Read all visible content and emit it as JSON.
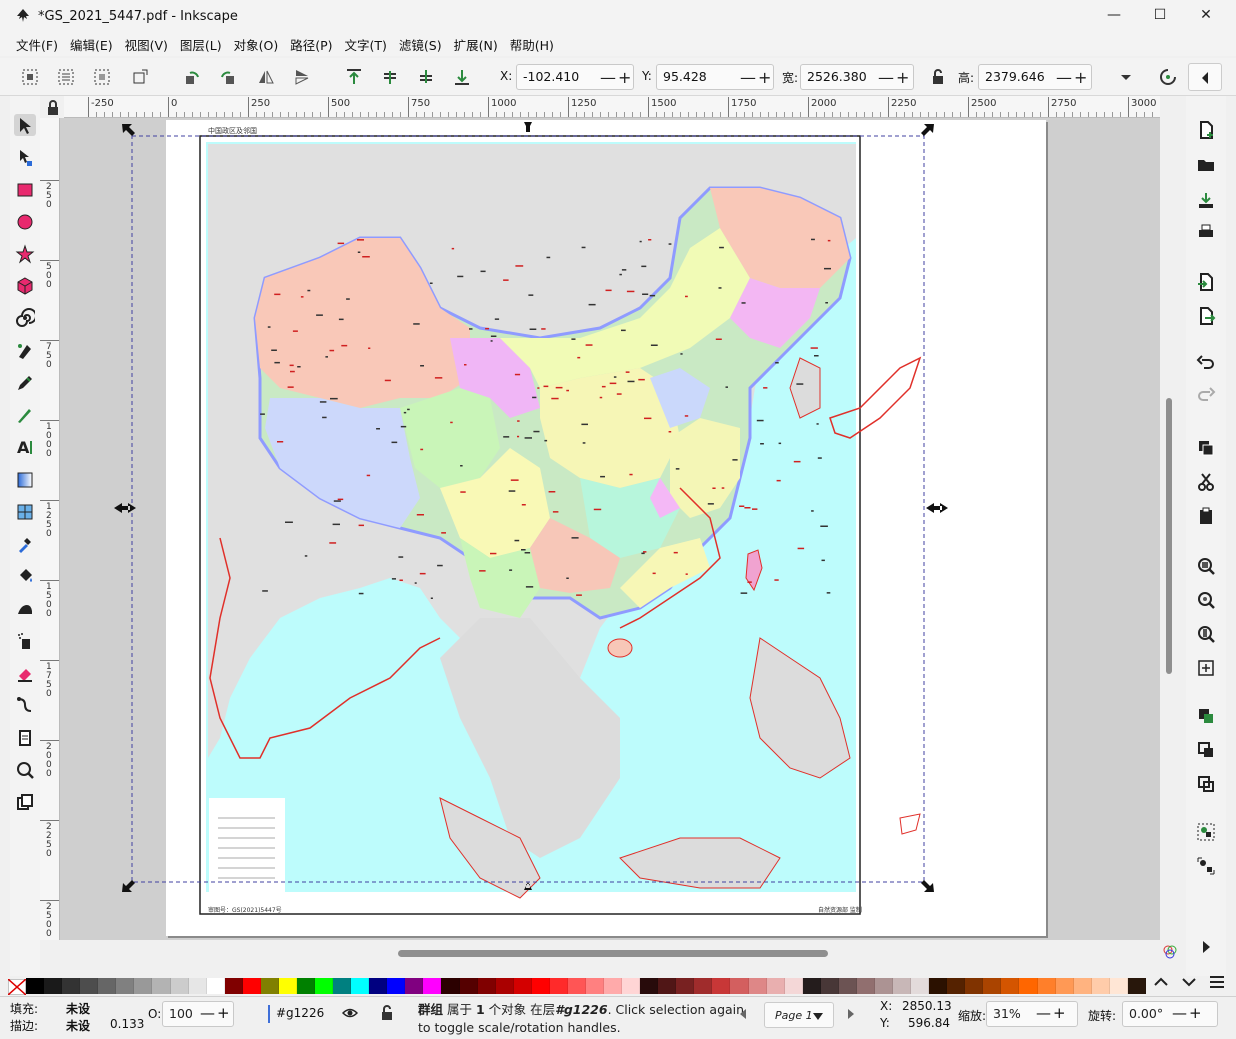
{
  "window": {
    "title": "*GS_2021_5447.pdf - Inkscape",
    "minimize": "—",
    "maximize": "☐",
    "close": "✕"
  },
  "menu": [
    "文件(F)",
    "编辑(E)",
    "视图(V)",
    "图层(L)",
    "对象(O)",
    "路径(P)",
    "文字(T)",
    "滤镜(S)",
    "扩展(N)",
    "帮助(H)"
  ],
  "toolbar": {
    "x_label": "X:",
    "x_value": "-102.410",
    "y_label": "Y:",
    "y_value": "95.428",
    "w_label": "宽:",
    "w_value": "2526.380",
    "h_label": "高:",
    "h_value": "2379.646",
    "plusminus": "—+"
  },
  "tools": [
    "selector-tool",
    "node-tool",
    "rectangle-tool",
    "ellipse-tool",
    "star-tool",
    "box3d-tool",
    "spiral-tool",
    "pen-tool",
    "pencil-tool",
    "calligraphy-tool",
    "text-tool",
    "gradient-tool",
    "mesh-tool",
    "dropper-tool",
    "paint-bucket-tool",
    "tweak-tool",
    "spray-tool",
    "eraser-tool",
    "connector-tool",
    "pages-tool",
    "zoom-tool",
    "measure-tool"
  ],
  "rulers": {
    "h": [
      "-250",
      "0",
      "250",
      "500",
      "750",
      "1000",
      "1250",
      "1500",
      "1750",
      "2000",
      "2250",
      "2500",
      "2750",
      "3000"
    ],
    "v": [
      "250",
      "500",
      "750",
      "1000",
      "1250",
      "1500",
      "1750",
      "2000",
      "2250",
      "2500"
    ]
  },
  "map": {
    "header_text": "中国政区及邻国",
    "footer_left": "审图号：GS(2021)5447号",
    "footer_right": "自然资源部 监制"
  },
  "palette": [
    "#000000",
    "#1a1a1a",
    "#333333",
    "#4d4d4d",
    "#666666",
    "#808080",
    "#999999",
    "#b3b3b3",
    "#cccccc",
    "#e6e6e6",
    "#ffffff",
    "#800000",
    "#ff0000",
    "#808000",
    "#ffff00",
    "#008000",
    "#00ff00",
    "#008080",
    "#00ffff",
    "#000080",
    "#0000ff",
    "#800080",
    "#ff00ff",
    "#2b0000",
    "#550000",
    "#800000",
    "#aa0000",
    "#d40000",
    "#ff0000",
    "#ff2a2a",
    "#ff5555",
    "#ff8080",
    "#ffaaaa",
    "#ffd5d5",
    "#280b0b",
    "#501616",
    "#782121",
    "#a02c2c",
    "#c83737",
    "#d35f5f",
    "#de8787",
    "#e9afaf",
    "#f4d7d7",
    "#241c1c",
    "#483737",
    "#6c5353",
    "#916f6f",
    "#ac9393",
    "#c8b7b7",
    "#e3dbdb",
    "#2b1100",
    "#552200",
    "#803300",
    "#aa4400",
    "#d45500",
    "#ff6600",
    "#ff7f2a",
    "#ff9955",
    "#ffb380",
    "#ffccaa",
    "#ffe6d5",
    "#28170b"
  ],
  "status": {
    "fill_label": "填充:",
    "fill_value": "未设",
    "stroke_label": "描边:",
    "stroke_value": "未设",
    "stroke_width": "0.133",
    "opacity_label": "O:",
    "opacity_value": "100",
    "layer_id": "#g1226",
    "message_bold": "群组",
    "message_1": " 属于 ",
    "message_count": "1",
    "message_2": " 个对象 在层",
    "message_layer": "#g1226",
    "message_3": ". Click selection again",
    "message_line2": "to toggle scale/rotation handles.",
    "page_label": "Page 1",
    "x_label": "X:",
    "x_value": "2850.13",
    "y_label": "Y:",
    "y_value": "596.84",
    "zoom_label": "缩放:",
    "zoom_value": "31%",
    "rotate_label": "旋转:",
    "rotate_value": "0.00°"
  }
}
